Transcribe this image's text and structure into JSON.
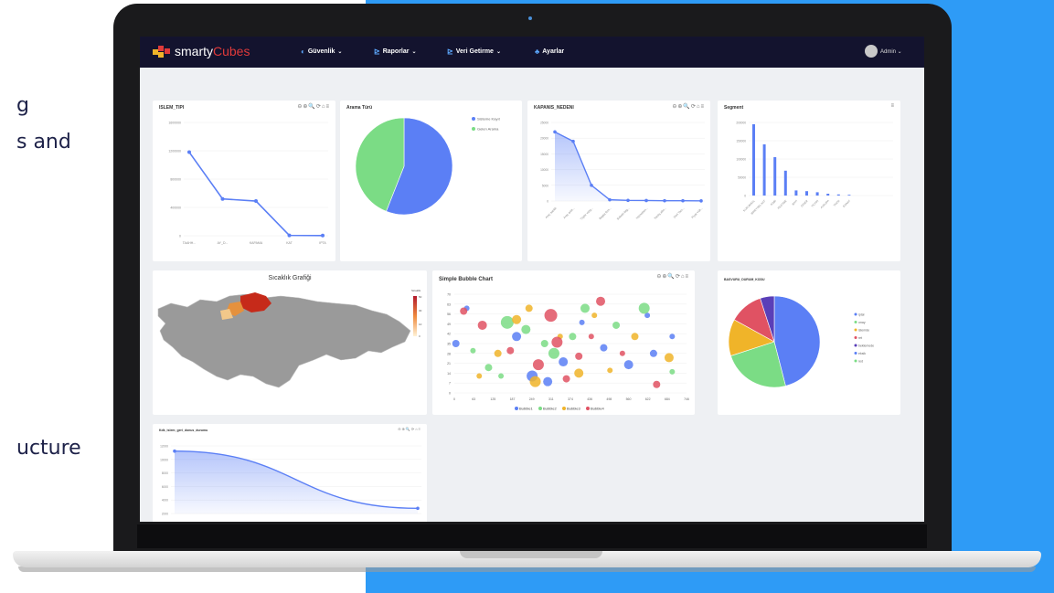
{
  "side_text": {
    "line1": "g",
    "line2": "s and",
    "line3": "ucture"
  },
  "navbar": {
    "logo_main": "smarty",
    "logo_accent": "Cubes",
    "items": [
      {
        "label": "Güvenlik",
        "icon": "shield-icon"
      },
      {
        "label": "Raporlar",
        "icon": "chart-line-icon"
      },
      {
        "label": "Veri Getirme",
        "icon": "chart-line-icon"
      },
      {
        "label": "Ayarlar",
        "icon": "users-icon"
      }
    ],
    "user": "Admin"
  },
  "colors": {
    "accent_blue": "#2e9bf6",
    "series_blue": "#5b7ff5",
    "green": "#7bdc85",
    "orange": "#f0b429",
    "red": "#e05263",
    "purple": "#5a3fb8",
    "nav": "#13132e"
  },
  "cards": {
    "islem": {
      "title": "ISLEM_TIPI",
      "tools": "⊖⊕🔍⟳⌂≡"
    },
    "arama": {
      "title": "Arama Türü",
      "tools": ""
    },
    "kapanis": {
      "title": "KAPANIS_NEDENI",
      "tools": "⊖⊕🔍⟳⌂≡"
    },
    "segment": {
      "title": "Segment",
      "tools": "≡"
    },
    "sicaklik": {
      "title": "Sıcaklık Grafiği",
      "legend_title": "Sicaklik",
      "legend_ticks": [
        "50",
        "30",
        "10",
        "0"
      ]
    },
    "bubble": {
      "title": "Simple Bubble Chart",
      "tools": "⊖⊕🔍⟳⌂≡"
    },
    "basvuru": {
      "title": "BASVURU_DURUM_KODU"
    },
    "area": {
      "title": "Kdk_islem_geri_donus_durumu",
      "tools": "⊖⊕🔍⟳⌂≡"
    }
  },
  "chart_data": [
    {
      "type": "line",
      "title": "ISLEM_TIPI",
      "categories": [
        "TAAHH...",
        "AY_D...",
        "KAPAMA",
        "KAT",
        "IPTA"
      ],
      "values": [
        1180000,
        520000,
        490000,
        5000,
        3000
      ],
      "ylim": [
        0,
        1600000
      ],
      "y_ticks": [
        "1600000",
        "1200000",
        "800000",
        "400000",
        "0"
      ]
    },
    {
      "type": "pie",
      "title": "Arama Türü",
      "labels": [
        "Sisteme Kayıt",
        "Gelen Arama"
      ],
      "values": [
        56,
        44
      ],
      "colors": [
        "#5b7ff5",
        "#7bdc85"
      ]
    },
    {
      "type": "area",
      "title": "KAPANIS_NEDENI",
      "categories": [
        "Araç satıldı",
        "Araç artık...",
        "Tüpte vazg...",
        "Başka firm...",
        "Sebebi bilg...",
        "Hizmetten...",
        "Yanlış abo...",
        "Dert Tanı...",
        "Fiyat Yük..."
      ],
      "values": [
        22000,
        19000,
        5000,
        400,
        200,
        150,
        100,
        80,
        50
      ],
      "ylim": [
        0,
        25000
      ],
      "y_ticks": [
        "25000",
        "20000",
        "15000",
        "10000",
        "5000",
        "0"
      ]
    },
    {
      "type": "bar",
      "title": "Segment",
      "categories": [
        "KURUMSAL",
        "BIREYSEL KAT",
        "KOBI",
        "ISLETME",
        "BAYI",
        "DIGER",
        "TICARI",
        "AVRUPA",
        "TAKSI",
        "ESNAF"
      ],
      "values": [
        195000,
        140000,
        105000,
        68000,
        14000,
        12000,
        9000,
        5000,
        3000,
        2000
      ],
      "ylim": [
        0,
        200000
      ],
      "y_ticks": [
        "200000",
        "150000",
        "100000",
        "50000",
        "0"
      ]
    },
    {
      "type": "scatter",
      "title": "Simple Bubble Chart",
      "xlabel": "",
      "ylabel": "",
      "x_ticks": [
        "0",
        "63",
        "125",
        "187",
        "249",
        "311",
        "374",
        "436",
        "498",
        "560",
        "622",
        "684",
        "746"
      ],
      "y_ticks": [
        "70",
        "63",
        "56",
        "49",
        "42",
        "35",
        "28",
        "21",
        "14",
        "7",
        "0"
      ],
      "series": [
        {
          "name": "Bubble1",
          "color": "#5b7ff5",
          "points": [
            [
              5,
              35,
              4
            ],
            [
              40,
              60,
              3
            ],
            [
              250,
              12,
              6
            ],
            [
              350,
              22,
              5
            ],
            [
              410,
              50,
              3
            ],
            [
              560,
              20,
              5
            ],
            [
              640,
              28,
              4
            ],
            [
              700,
              40,
              3
            ],
            [
              200,
              40,
              5
            ],
            [
              480,
              32,
              4
            ],
            [
              300,
              8,
              5
            ],
            [
              620,
              55,
              3
            ]
          ]
        },
        {
          "name": "Bubble2",
          "color": "#7bdc85",
          "points": [
            [
              60,
              30,
              3
            ],
            [
              110,
              18,
              4
            ],
            [
              170,
              50,
              7
            ],
            [
              230,
              45,
              5
            ],
            [
              290,
              35,
              4
            ],
            [
              320,
              28,
              6
            ],
            [
              420,
              60,
              5
            ],
            [
              520,
              48,
              4
            ],
            [
              610,
              60,
              6
            ],
            [
              700,
              15,
              3
            ],
            [
              150,
              12,
              3
            ],
            [
              380,
              40,
              4
            ]
          ]
        },
        {
          "name": "Bubble3",
          "color": "#f0b429",
          "points": [
            [
              80,
              12,
              3
            ],
            [
              140,
              28,
              4
            ],
            [
              200,
              52,
              5
            ],
            [
              260,
              8,
              6
            ],
            [
              340,
              40,
              3
            ],
            [
              400,
              14,
              5
            ],
            [
              500,
              16,
              3
            ],
            [
              580,
              40,
              4
            ],
            [
              690,
              25,
              5
            ],
            [
              450,
              55,
              3
            ],
            [
              240,
              60,
              4
            ]
          ]
        },
        {
          "name": "Bubble4",
          "color": "#e05263",
          "points": [
            [
              30,
              58,
              4
            ],
            [
              90,
              48,
              5
            ],
            [
              180,
              30,
              4
            ],
            [
              270,
              20,
              6
            ],
            [
              310,
              55,
              7
            ],
            [
              360,
              10,
              4
            ],
            [
              440,
              40,
              3
            ],
            [
              470,
              65,
              5
            ],
            [
              540,
              28,
              3
            ],
            [
              650,
              6,
              4
            ],
            [
              330,
              36,
              6
            ],
            [
              400,
              26,
              4
            ]
          ]
        }
      ]
    },
    {
      "type": "pie",
      "title": "BASVURU_DURUM_KODU",
      "labels": [
        "iptal",
        "onay",
        "islemde",
        "ret",
        "beklemede",
        "eksik",
        "red"
      ],
      "values": [
        46,
        24,
        13,
        12,
        5
      ],
      "colors": [
        "#5b7ff5",
        "#7bdc85",
        "#f0b429",
        "#e05263",
        "#5a3fb8"
      ],
      "legend_entries": [
        "blue",
        "green",
        "orange",
        "red",
        "purple",
        "blue2",
        "green2"
      ]
    },
    {
      "type": "area",
      "title": "Kdk_islem_geri_donus_durumu",
      "categories": [
        "a",
        "b"
      ],
      "values": [
        12000,
        1000
      ],
      "ylim": [
        0,
        13000
      ],
      "y_ticks": [
        "12000",
        "10000",
        "8000",
        "6000",
        "4000",
        "2000"
      ]
    }
  ]
}
